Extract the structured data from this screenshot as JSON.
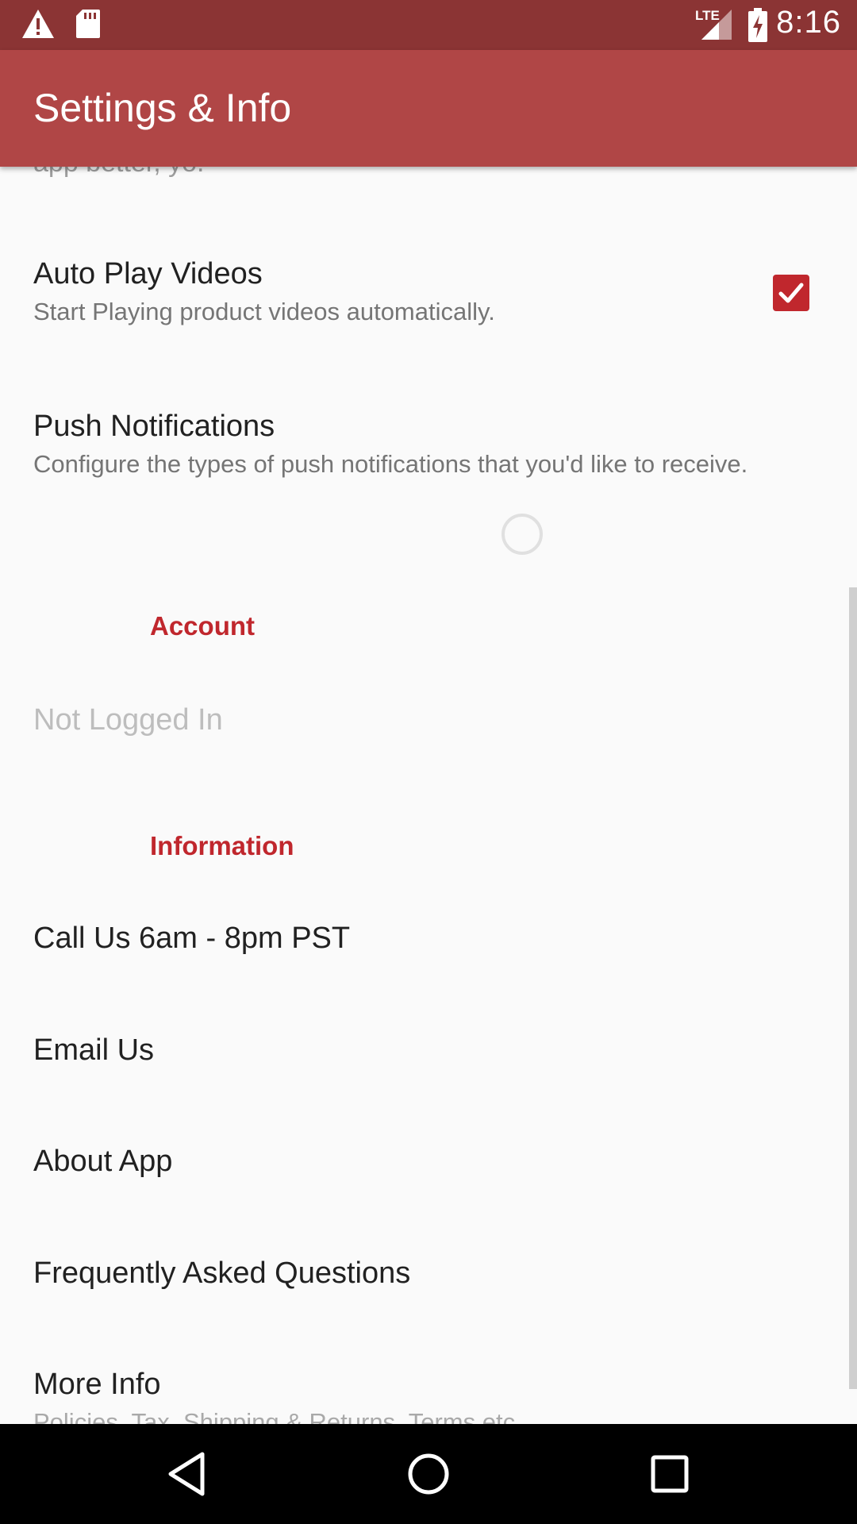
{
  "status_bar": {
    "time": "8:16",
    "network": "LTE",
    "icons": [
      "warning-icon",
      "sd-card-icon",
      "lte-signal-icon",
      "battery-charging-icon"
    ]
  },
  "toolbar": {
    "title": "Settings & Info"
  },
  "content": {
    "partial_top_text": "app better, yo.",
    "auto_play": {
      "title": "Auto Play Videos",
      "summary": "Start Playing product videos automatically.",
      "checked": true
    },
    "push_notifications": {
      "title": "Push Notifications",
      "summary": "Configure the types of push notifications that you'd like to receive."
    },
    "account_header": "Account",
    "not_logged_in": "Not Logged In",
    "information_header": "Information",
    "call_us": "Call Us 6am - 8pm PST",
    "email_us": "Email Us",
    "about_app": "About App",
    "faq": "Frequently Asked Questions",
    "more_info": "More Info",
    "more_info_summary_partial": "Policies, Tax, Shipping & Returns, Terms etc"
  },
  "colors": {
    "status_bar": "#8b3434",
    "toolbar": "#b04646",
    "accent": "#c0272d",
    "background": "#fafafa"
  },
  "nav_bar": {
    "icons": [
      "back-icon",
      "home-icon",
      "recents-icon"
    ]
  }
}
